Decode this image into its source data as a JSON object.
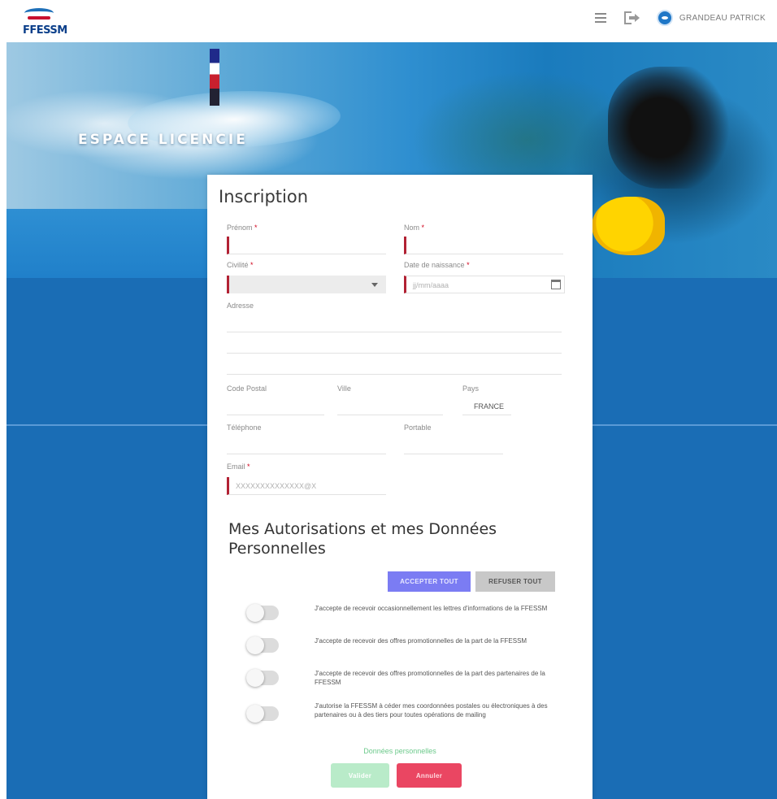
{
  "header": {
    "logo_text": "FFESSM",
    "user_name": "GRANDEAU PATRICK",
    "menu_icon": "menu-icon",
    "logout_icon": "logout-icon",
    "avatar_icon": "avatar"
  },
  "hero": {
    "title": "ESPACE LICENCIE"
  },
  "form": {
    "title": "Inscription",
    "fields": {
      "prenom": {
        "label": "Prénom",
        "value": ""
      },
      "nom": {
        "label": "Nom",
        "value": ""
      },
      "civilite": {
        "label": "Civilité",
        "value": ""
      },
      "naissance": {
        "label": "Date de naissance",
        "placeholder": "jj/mm/aaaa"
      },
      "adresse": {
        "label": "Adresse"
      },
      "code_postal": {
        "label": "Code Postal"
      },
      "ville": {
        "label": "Ville"
      },
      "pays": {
        "label": "Pays",
        "value": "FRANCE"
      },
      "telephone": {
        "label": "Téléphone"
      },
      "portable": {
        "label": "Portable"
      },
      "email": {
        "label": "Email",
        "placeholder": "XXXXXXXXXXXXXX@X"
      }
    },
    "required_marker": "*"
  },
  "authorizations": {
    "title": "Mes Autorisations et mes Données Personnelles",
    "accept_all": "ACCEPTER TOUT",
    "refuse_all": "REFUSER TOUT",
    "items": [
      {
        "text": "J'accepte de recevoir occasionnellement les lettres d'informations de la FFESSM",
        "enabled": false
      },
      {
        "text": "J'accepte de recevoir des offres promotionnelles de la part de la FFESSM",
        "enabled": false
      },
      {
        "text": "J'accepte de recevoir des offres promotionnelles de la part des partenaires de la FFESSM",
        "enabled": false
      },
      {
        "text": "J'autorise la FFESSM à céder mes coordonnées postales ou électroniques à des partenaires ou à des tiers pour toutes opérations de mailing",
        "enabled": false
      }
    ],
    "learn_more": "Données personnelles"
  },
  "actions": {
    "submit": "Valider",
    "cancel": "Annuler"
  },
  "colors": {
    "brand_blue": "#1a6db5",
    "accept_purple": "#7b7cf3",
    "cancel_red": "#ea4662",
    "submit_green": "#b9ebc9",
    "required_red": "#b22234"
  }
}
